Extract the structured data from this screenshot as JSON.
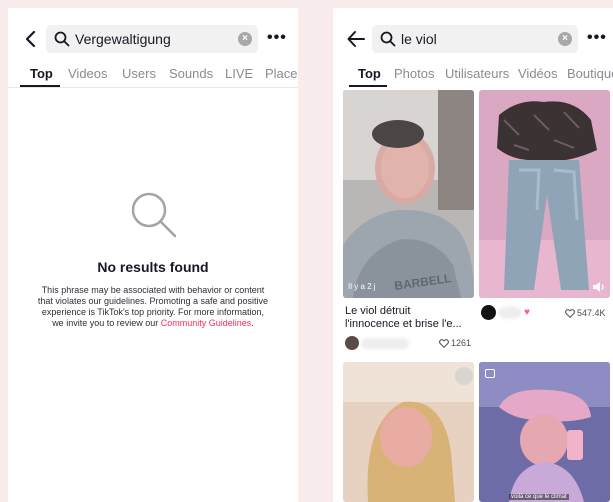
{
  "left": {
    "search_query": "Vergewaltigung",
    "tabs": [
      "Top",
      "Videos",
      "Users",
      "Sounds",
      "LIVE",
      "Places"
    ],
    "no_results": {
      "title": "No results found",
      "body_line1": "This phrase may be associated with behavior or content",
      "body_line2": "that violates our guidelines. Promoting a safe and positive",
      "body_line3": "experience is TikTok's top priority. For more information,",
      "body_line4_prefix": "we invite you to review our ",
      "link": "Community Guidelines",
      "body_line4_suffix": "."
    }
  },
  "right": {
    "search_query": "le viol",
    "tabs": [
      "Top",
      "Photos",
      "Utilisateurs",
      "Vidéos",
      "Boutique"
    ],
    "results": [
      {
        "timestamp": "Il y a 2 j",
        "caption_line1": "Le viol détruit",
        "caption_line2": "l'innocence et brise l'e...",
        "likes": "1261"
      },
      {
        "likes": "547.4K"
      },
      {},
      {
        "overlay_text": "voilà ce que le climat"
      }
    ]
  }
}
